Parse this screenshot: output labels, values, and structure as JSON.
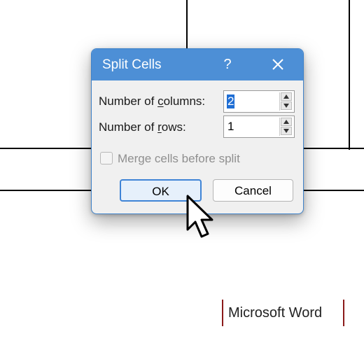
{
  "dialog": {
    "title": "Split Cells",
    "help_glyph": "?",
    "columns_label_pre": "Number of ",
    "columns_label_ul": "c",
    "columns_label_post": "olumns:",
    "columns_value": "2",
    "rows_label_pre": "Number of ",
    "rows_label_ul": "r",
    "rows_label_post": "ows:",
    "rows_value": "1",
    "merge_label": "Merge cells before split",
    "merge_checked": false,
    "ok_label": "OK",
    "cancel_label": "Cancel"
  },
  "watermark": {
    "text": "Microsoft Word",
    "accent_color": "#8b1a1a"
  },
  "colors": {
    "titlebar": "#4d8fd6",
    "selection": "#1f6ed4",
    "ok_border": "#3f84d6"
  }
}
